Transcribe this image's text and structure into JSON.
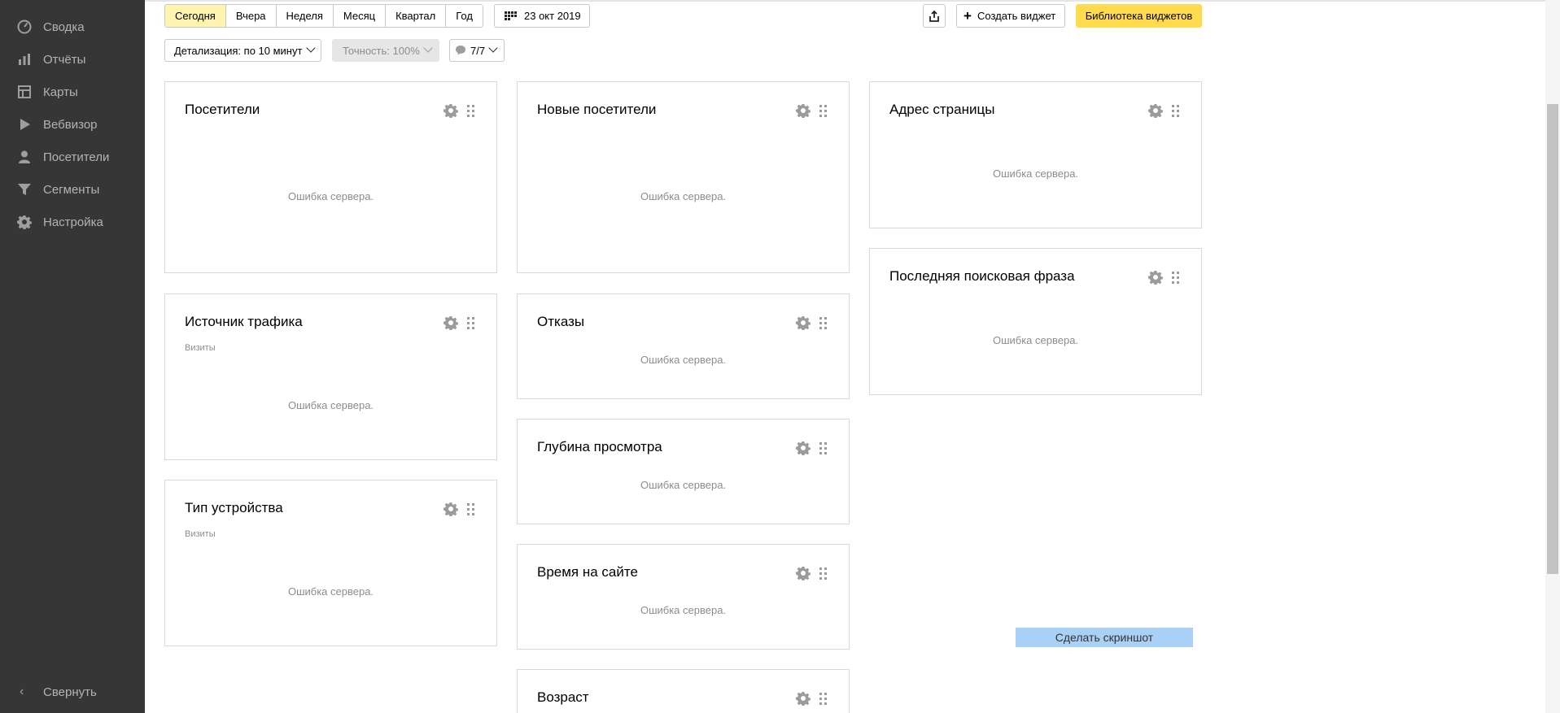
{
  "sidebar": {
    "items": [
      {
        "label": "Сводка",
        "icon": "gauge-icon"
      },
      {
        "label": "Отчёты",
        "icon": "bar-chart-icon"
      },
      {
        "label": "Карты",
        "icon": "map-layout-icon"
      },
      {
        "label": "Вебвизор",
        "icon": "play-icon"
      },
      {
        "label": "Посетители",
        "icon": "user-icon"
      },
      {
        "label": "Сегменты",
        "icon": "filter-icon"
      },
      {
        "label": "Настройка",
        "icon": "gear-icon"
      }
    ],
    "collapse_label": "Свернуть"
  },
  "toolbar": {
    "periods": [
      "Сегодня",
      "Вчера",
      "Неделя",
      "Месяц",
      "Квартал",
      "Год"
    ],
    "active_period": "Сегодня",
    "date_label": "23 окт 2019",
    "create_widget_label": "Создать виджет",
    "library_label": "Библиотека виджетов"
  },
  "filters": {
    "detail_label": "Детализация: по 10 минут",
    "accuracy_label": "Точность: 100%",
    "comments_label": "7/7"
  },
  "widgets": {
    "visitors": {
      "title": "Посетители",
      "error": "Ошибка сервера."
    },
    "traffic_source": {
      "title": "Источник трафика",
      "subtitle": "Визиты",
      "error": "Ошибка сервера."
    },
    "device_type": {
      "title": "Тип устройства",
      "subtitle": "Визиты",
      "error": "Ошибка сервера."
    },
    "new_visitors": {
      "title": "Новые посетители",
      "error": "Ошибка сервера."
    },
    "bounces": {
      "title": "Отказы",
      "error": "Ошибка сервера."
    },
    "depth": {
      "title": "Глубина просмотра",
      "error": "Ошибка сервера."
    },
    "time_on_site": {
      "title": "Время на сайте",
      "error": "Ошибка сервера."
    },
    "age": {
      "title": "Возраст"
    },
    "page_url": {
      "title": "Адрес страницы",
      "error": "Ошибка сервера."
    },
    "last_search": {
      "title": "Последняя поисковая фраза",
      "error": "Ошибка сервера."
    }
  },
  "screenshot_label": "Сделать скриншот",
  "colors": {
    "sidebar_bg": "#363636",
    "active_period_bg": "#fff3b0",
    "library_button_bg": "#ffdb4d",
    "screenshot_button_bg": "#a8d1f5"
  }
}
